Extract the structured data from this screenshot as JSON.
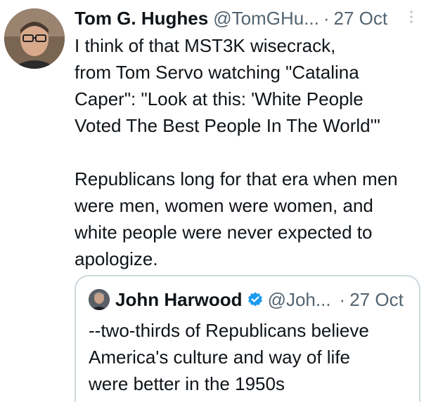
{
  "tweet": {
    "author_name": "Tom G. Hughes",
    "handle": "@TomGHu...",
    "separator": "·",
    "date": "27 Oct",
    "more_icon": "more-vertical-icon",
    "text": "I think of that MST3K wisecrack,\nfrom Tom Servo watching \"Catalina\nCaper\": \"Look at this: 'White People\nVoted The Best People In The World'\"\n\nRepublicans long for that era when men\nwere men, women were women, and\nwhite people were never expected to\napologize."
  },
  "quoted_tweet": {
    "author_name": "John Harwood",
    "verified_icon": "verified-badge-icon",
    "handle": "@Joh...",
    "separator": "·",
    "date": "27 Oct",
    "text": "--two-thirds of Republicans believe\nAmerica's culture and way of life\nwere better in the 1950s"
  },
  "colors": {
    "primary_text": "#0f1419",
    "secondary_text": "#536471",
    "border": "#cfd9de",
    "verified": "#1d9bf0"
  }
}
